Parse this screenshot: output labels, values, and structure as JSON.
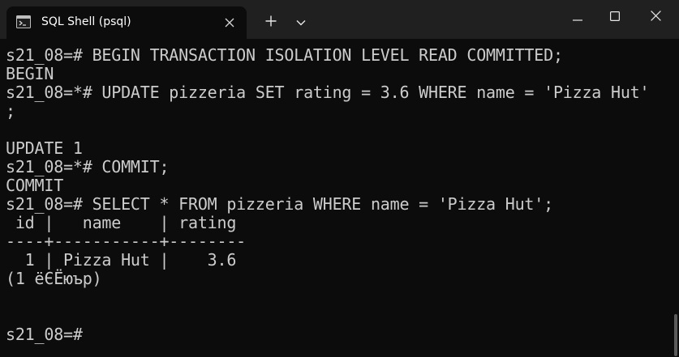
{
  "window": {
    "tab_title": "SQL Shell (psql)",
    "tab_icon": "terminal-icon",
    "new_tab_icon": "plus-icon",
    "dropdown_icon": "chevron-down-icon",
    "minimize_icon": "minimize-icon",
    "maximize_icon": "maximize-icon",
    "close_icon": "close-icon",
    "titlebar_color": "#202020",
    "background_color": "#0c0c0c",
    "text_color": "#cccccc"
  },
  "terminal": {
    "lines": [
      "s21_08=# BEGIN TRANSACTION ISOLATION LEVEL READ COMMITTED;",
      "BEGIN",
      "s21_08=*# UPDATE pizzeria SET rating = 3.6 WHERE name = 'Pizza Hut'",
      ";",
      "",
      "UPDATE 1",
      "s21_08=*# COMMIT;",
      "COMMIT",
      "s21_08=# SELECT * FROM pizzeria WHERE name = 'Pizza Hut';",
      " id |   name    | rating",
      "----+-----------+--------",
      "  1 | Pizza Hut |    3.6",
      "(1 ёЄЁюър)",
      "",
      "",
      "s21_08=#"
    ]
  }
}
